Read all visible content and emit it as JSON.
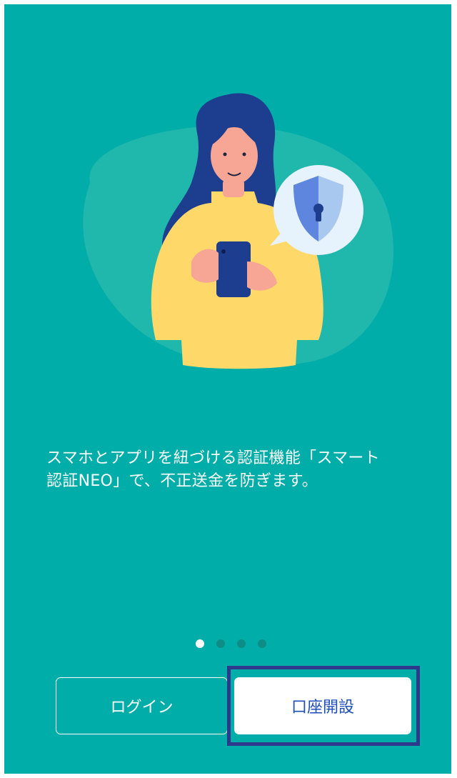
{
  "onboarding": {
    "description": "スマホとアプリを紐づける認証機能「スマート\n認証NEO」で、不正送金を防ぎます。",
    "page_indicator": {
      "total": 4,
      "current": 1
    }
  },
  "buttons": {
    "login_label": "ログイン",
    "open_account_label": "口座開設"
  },
  "colors": {
    "background": "#00ADA8",
    "blob": "#20B7AC",
    "shirt": "#FFD86A",
    "hair": "#1D3D8E",
    "skin": "#F7A594",
    "shield_light": "#A9C8F0",
    "shield_dark": "#5E86DE",
    "button_text_primary": "#1E4FB8",
    "highlight_border": "#2D3A8C"
  }
}
